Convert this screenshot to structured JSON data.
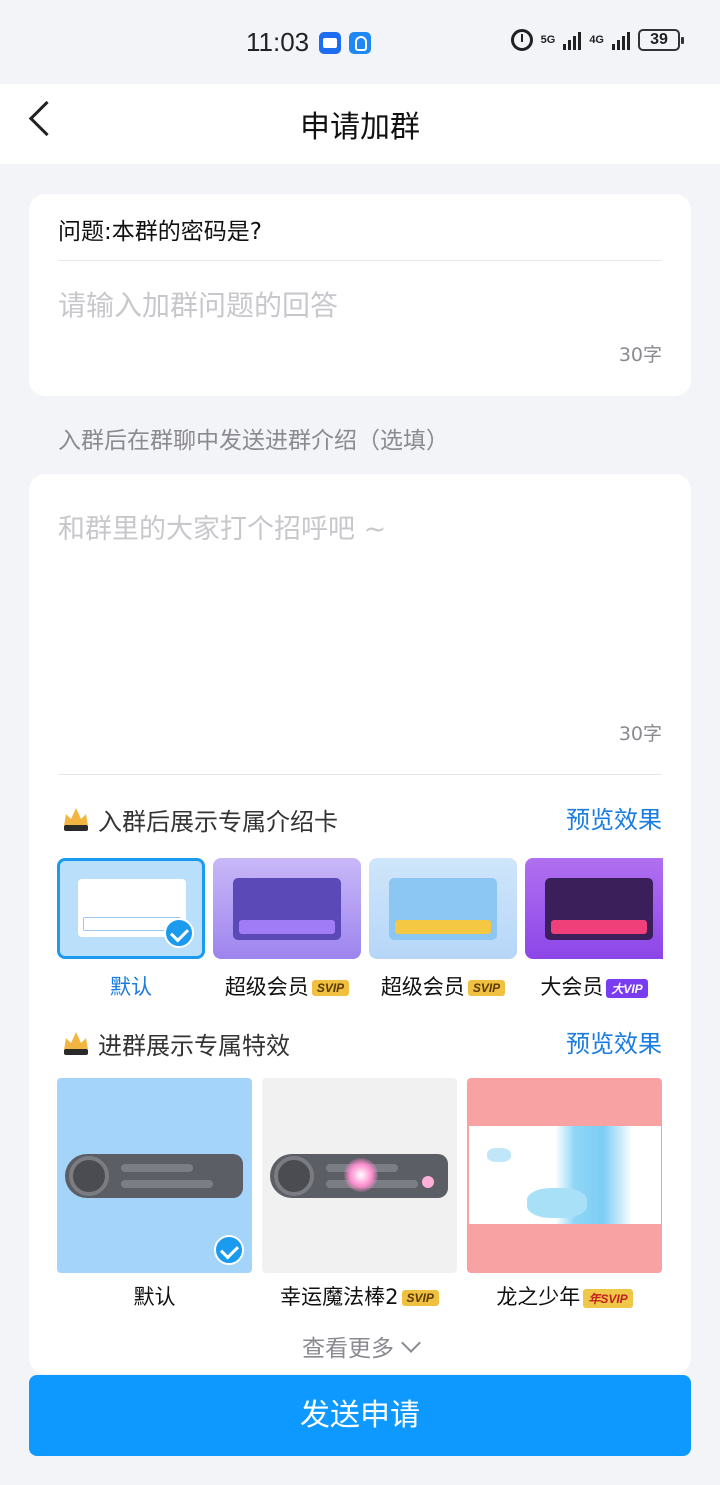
{
  "status_bar": {
    "time": "11:03",
    "net1": "5G",
    "net2": "4G",
    "battery": "39"
  },
  "header": {
    "title": "申请加群"
  },
  "question_card": {
    "question": "问题:本群的密码是?",
    "answer_placeholder": "请输入加群问题的回答",
    "answer_value": "",
    "counter": "30字"
  },
  "intro_hint": "入群后在群聊中发送进群介绍（选填）",
  "intro_card": {
    "placeholder": "和群里的大家打个招呼吧 ~",
    "counter": "30字",
    "card_section": {
      "label": "入群后展示专属介绍卡",
      "preview": "预览效果",
      "options": [
        {
          "name": "默认",
          "badge": "",
          "selected": true
        },
        {
          "name": "超级会员",
          "badge": "SVIP",
          "selected": false
        },
        {
          "name": "超级会员",
          "badge": "SVIP",
          "selected": false
        },
        {
          "name": "大会员",
          "badge": "大VIP",
          "selected": false
        }
      ]
    },
    "effect_section": {
      "label": "进群展示专属特效",
      "preview": "预览效果",
      "options": [
        {
          "name": "默认",
          "badge": "",
          "selected": true
        },
        {
          "name": "幸运魔法棒2",
          "badge": "SVIP",
          "selected": false
        },
        {
          "name": "龙之少年",
          "badge": "年SVIP",
          "selected": false
        }
      ]
    },
    "more": "查看更多"
  },
  "send_button": "发送申请",
  "colors": {
    "accent": "#0d99ff",
    "link": "#1a7be0",
    "background": "#f3f4f8"
  }
}
